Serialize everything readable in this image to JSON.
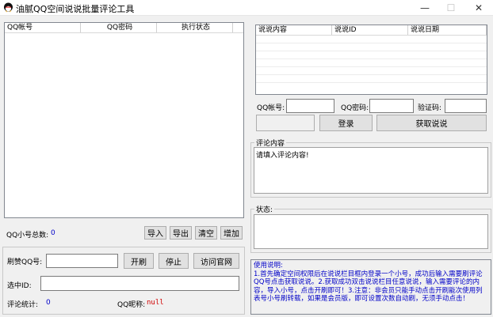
{
  "window": {
    "title": "油腻QQ空间说说批量评论工具",
    "min": "—",
    "max": "☐",
    "close": "✕"
  },
  "account_list": {
    "columns": [
      "QQ帐号",
      "QQ密码",
      "执行状态"
    ],
    "total_label": "QQ小号总数:",
    "total_value": "0",
    "buttons": {
      "import": "导入",
      "export": "导出",
      "clear": "清空",
      "add": "增加"
    }
  },
  "shuoshuo_list": {
    "columns": [
      "说说内容",
      "说说ID",
      "说说日期"
    ]
  },
  "login": {
    "account_label": "QQ帐号:",
    "password_label": "QQ密码:",
    "captcha_label": "验证码:",
    "login_button": "登录",
    "fetch_button": "获取说说"
  },
  "comment": {
    "group_title": "评论内容",
    "text": "请填入评论内容!"
  },
  "status": {
    "group_title": "状态:"
  },
  "brush": {
    "qq_label": "刷赞QQ号:",
    "start_button": "开刷",
    "stop_button": "停止",
    "visit_button": "访问官网",
    "selected_id_label": "选中ID:",
    "stats_label": "评论统计:",
    "stats_value": "0",
    "nickname_label": "QQ昵称:",
    "nickname_value": "null"
  },
  "instructions": {
    "title": "使用说明:",
    "body": "1.首先确定空间权限后在说说栏目框内登录一个小号，成功后输入需要刷评论QQ号点击获取说说。2.获取成功双击说说栏目任意说说，输入需要评论的内容，导入小号，点击开刷即可！3.注意：非会员只能手动点击开刷能次使用列表号小号刷转载，如果是会员版，即可设置次数自动刷，无须手动点击！"
  },
  "colors": {
    "instruction_text": "#0000c8",
    "stats_value": "#0000c8",
    "nickname_value": "#d00000"
  }
}
